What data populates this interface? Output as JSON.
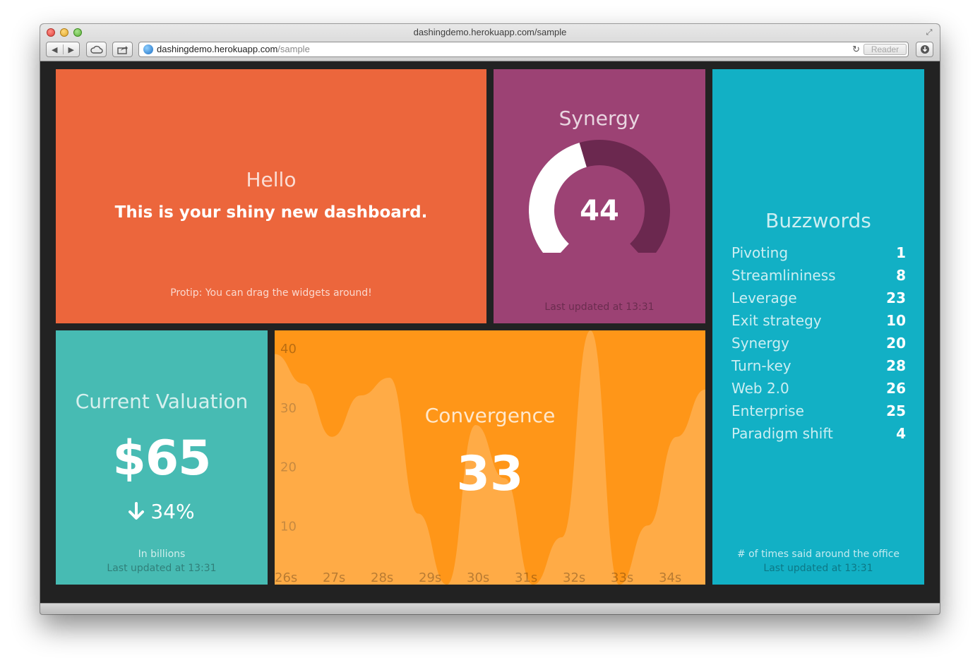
{
  "browser": {
    "title": "dashingdemo.herokuapp.com/sample",
    "url_host": "dashingdemo.herokuapp.com",
    "url_path": "/sample",
    "reader_label": "Reader"
  },
  "widgets": {
    "welcome": {
      "title": "Hello",
      "text": "This is your shiny new dashboard.",
      "moreinfo": "Protip: You can drag the widgets around!",
      "color": "#ec663c"
    },
    "synergy": {
      "title": "Synergy",
      "value": "44",
      "min": 0,
      "max": 100,
      "updated": "Last updated at 13:31",
      "color": "#9c4274"
    },
    "buzzwords": {
      "title": "Buzzwords",
      "items": [
        {
          "label": "Pivoting",
          "value": "1"
        },
        {
          "label": "Streamlininess",
          "value": "8"
        },
        {
          "label": "Leverage",
          "value": "23"
        },
        {
          "label": "Exit strategy",
          "value": "10"
        },
        {
          "label": "Synergy",
          "value": "20"
        },
        {
          "label": "Turn-key",
          "value": "28"
        },
        {
          "label": "Web 2.0",
          "value": "26"
        },
        {
          "label": "Enterprise",
          "value": "25"
        },
        {
          "label": "Paradigm shift",
          "value": "4"
        }
      ],
      "moreinfo": "# of times said around the office",
      "updated": "Last updated at 13:31",
      "color": "#12b0c5"
    },
    "valuation": {
      "title": "Current Valuation",
      "value": "$65",
      "change": "34%",
      "change_icon": "arrow-down-icon",
      "moreinfo": "In billions",
      "updated": "Last updated at 13:31",
      "color": "#47bbb3"
    },
    "convergence": {
      "title": "Convergence",
      "value": "33",
      "color": "#ff9618"
    }
  },
  "chart_data": {
    "type": "area",
    "x": [
      "25s",
      "25.5s",
      "26s",
      "26.5s",
      "27s",
      "27.5s",
      "28s",
      "28.5s",
      "29s",
      "29.5s",
      "30s",
      "30.5s",
      "31s",
      "31.5s",
      "32s",
      "32.5s",
      "33s",
      "33.5s",
      "34s",
      "34.5s",
      "35s"
    ],
    "x_ticks": [
      "26s",
      "27s",
      "28s",
      "29s",
      "30s",
      "31s",
      "32s",
      "33s",
      "34s"
    ],
    "values": [
      39,
      34,
      25,
      32,
      35,
      12,
      0,
      27,
      18,
      0,
      8,
      43,
      0,
      10,
      25,
      33
    ],
    "y_ticks": [
      "10",
      "20",
      "30",
      "40"
    ],
    "ylim": [
      0,
      43
    ],
    "title": "",
    "xlabel": "",
    "ylabel": ""
  }
}
